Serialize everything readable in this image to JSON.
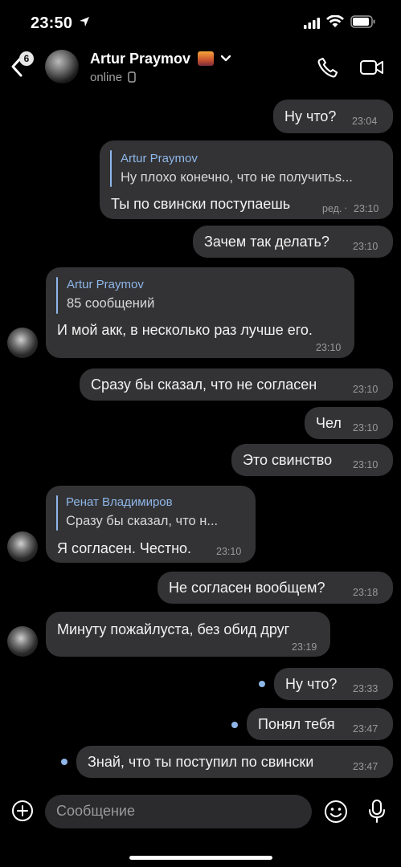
{
  "status_bar": {
    "time": "23:50"
  },
  "header": {
    "back_badge": "6",
    "contact_name": "Artur Praymov",
    "contact_status": "online"
  },
  "messages": [
    {
      "text": "Ну что?",
      "time": "23:04"
    },
    {
      "reply_name": "Artur Praymov",
      "reply_text": "Ну плохо конечно, что не получитьs...",
      "text": "Ты по свински поступаешь",
      "edited": "ред.",
      "time": "23:10"
    },
    {
      "text": "Зачем так делать?",
      "time": "23:10"
    },
    {
      "reply_name": "Artur Praymov",
      "reply_text": "85 сообщений",
      "text": "И мой акк, в несколько раз лучше его.",
      "time": "23:10"
    },
    {
      "text": "Сразу бы сказал, что не согласен",
      "time": "23:10"
    },
    {
      "text": "Чел",
      "time": "23:10"
    },
    {
      "text": "Это свинство",
      "time": "23:10"
    },
    {
      "reply_name": "Ренат Владимиров",
      "reply_text": "Сразу бы сказал, что н...",
      "text": "Я согласен. Честно.",
      "time": "23:10"
    },
    {
      "text": "Не согласен вообщем?",
      "time": "23:18"
    },
    {
      "text": "Минуту пожайлуста, без обид друг",
      "time": "23:19"
    },
    {
      "text": "Ну что?",
      "time": "23:33"
    },
    {
      "text": "Понял тебя",
      "time": "23:47"
    },
    {
      "text": "Знай, что ты поступил по свински",
      "time": "23:47"
    }
  ],
  "composer": {
    "placeholder": "Сообщение"
  },
  "colors": {
    "background": "#000000",
    "bubble": "#333335",
    "accent": "#8fb6e8"
  }
}
